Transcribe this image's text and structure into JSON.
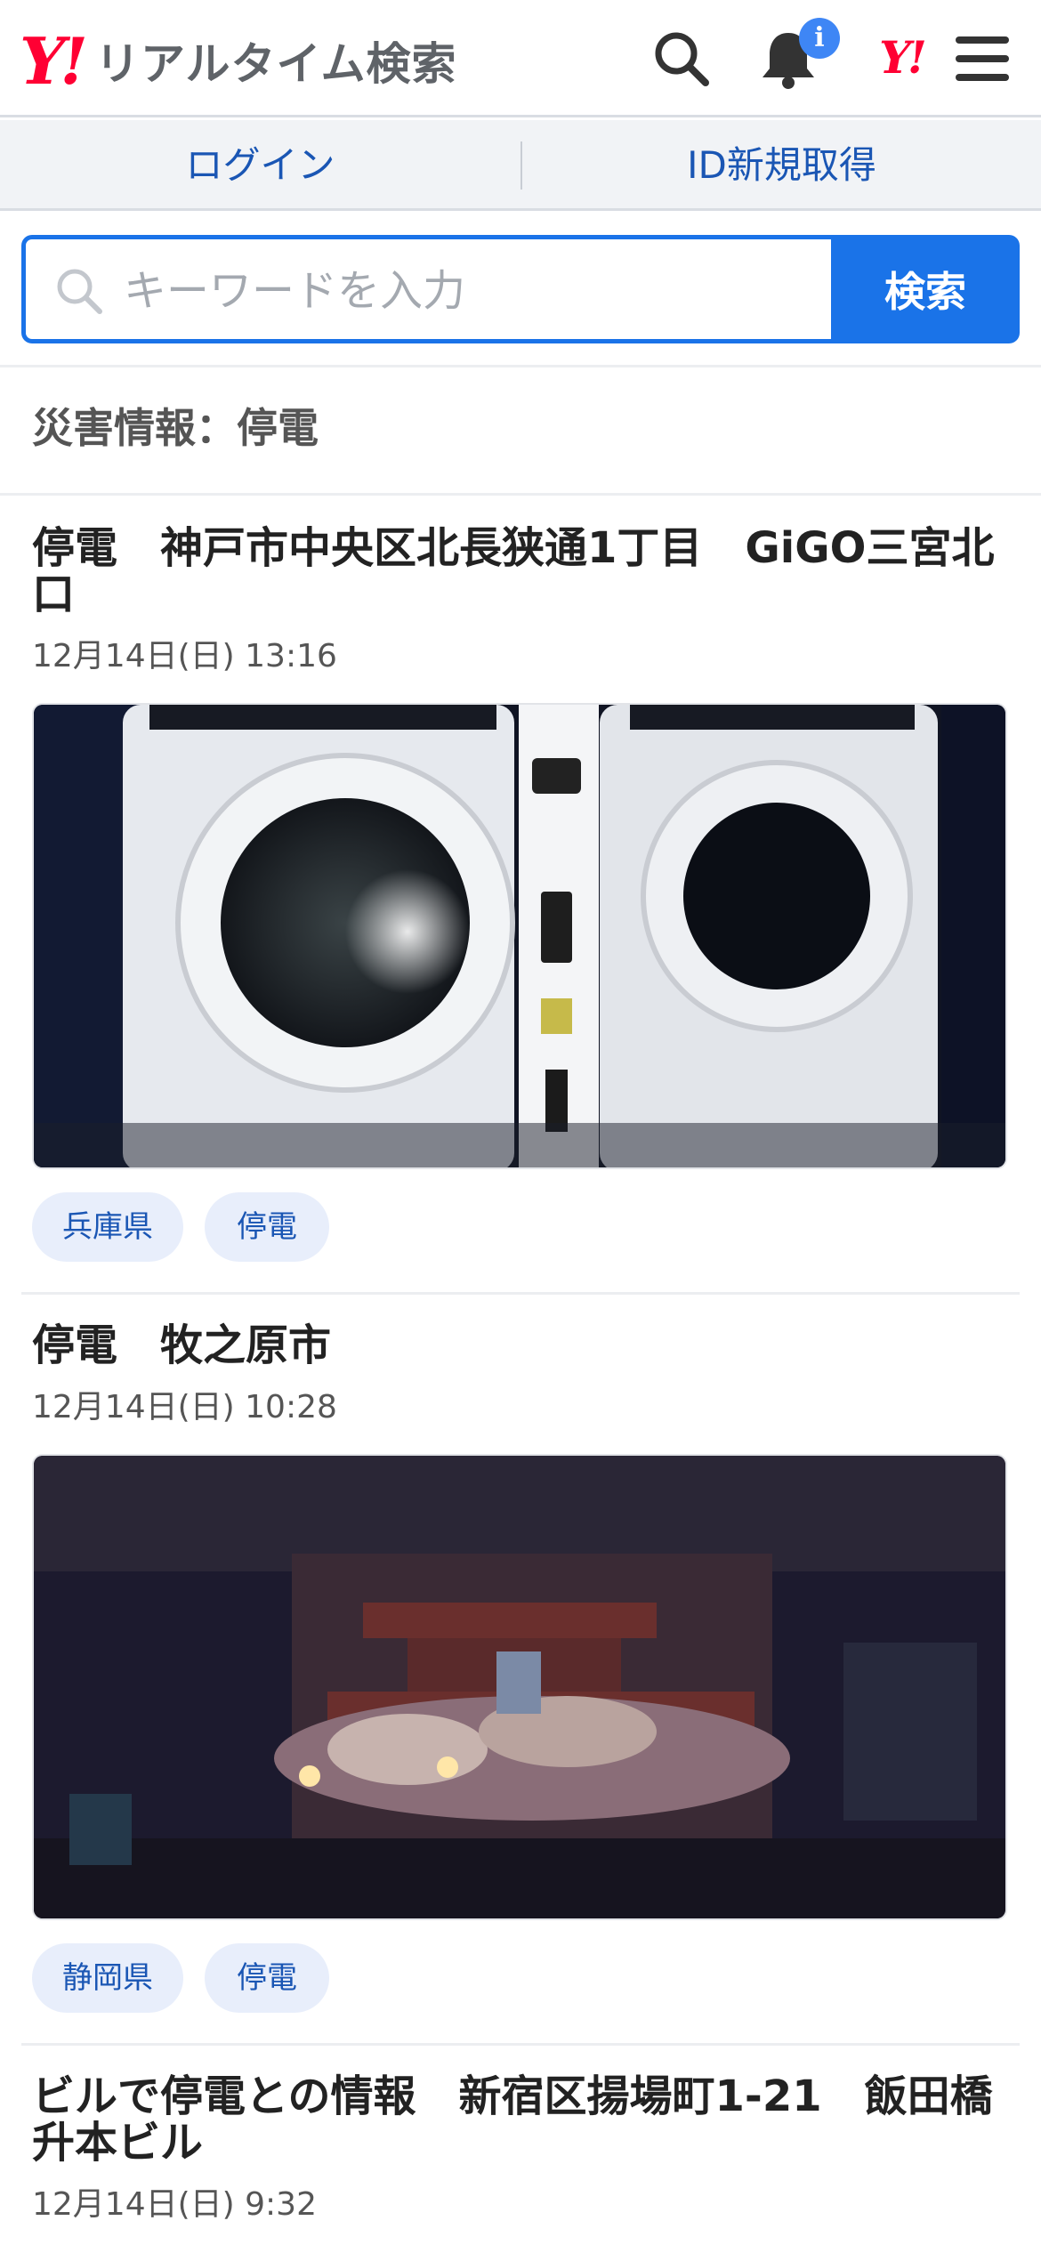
{
  "header": {
    "logo_mark": "Y!",
    "service_name": "リアルタイム検索",
    "notification_badge": "i",
    "yahoo_icon_label": "Y!"
  },
  "account": {
    "login_label": "ログイン",
    "register_label": "ID新規取得"
  },
  "search": {
    "placeholder": "キーワードを入力",
    "value": "",
    "button_label": "検索"
  },
  "section": {
    "title": "災害情報：停電"
  },
  "posts": [
    {
      "title": "停電　神戸市中央区北長狭通1丁目　GiGO三宮北口",
      "time": "12月14日(日) 13:16",
      "image_icon": "arcade-machine-photo",
      "tags": [
        "兵庫県",
        "停電"
      ]
    },
    {
      "title": "停電　牧之原市",
      "time": "12月14日(日) 10:28",
      "image_icon": "funeral-altar-photo",
      "tags": [
        "静岡県",
        "停電"
      ]
    },
    {
      "title": "ビルで停電との情報　新宿区揚場町1-21　飯田橋升本ビル",
      "time": "12月14日(日) 9:32"
    }
  ],
  "colors": {
    "brand_red": "#ff0033",
    "accent_blue": "#1a73e8",
    "link_blue": "#1a56b4",
    "tag_bg": "#e8eefb"
  }
}
